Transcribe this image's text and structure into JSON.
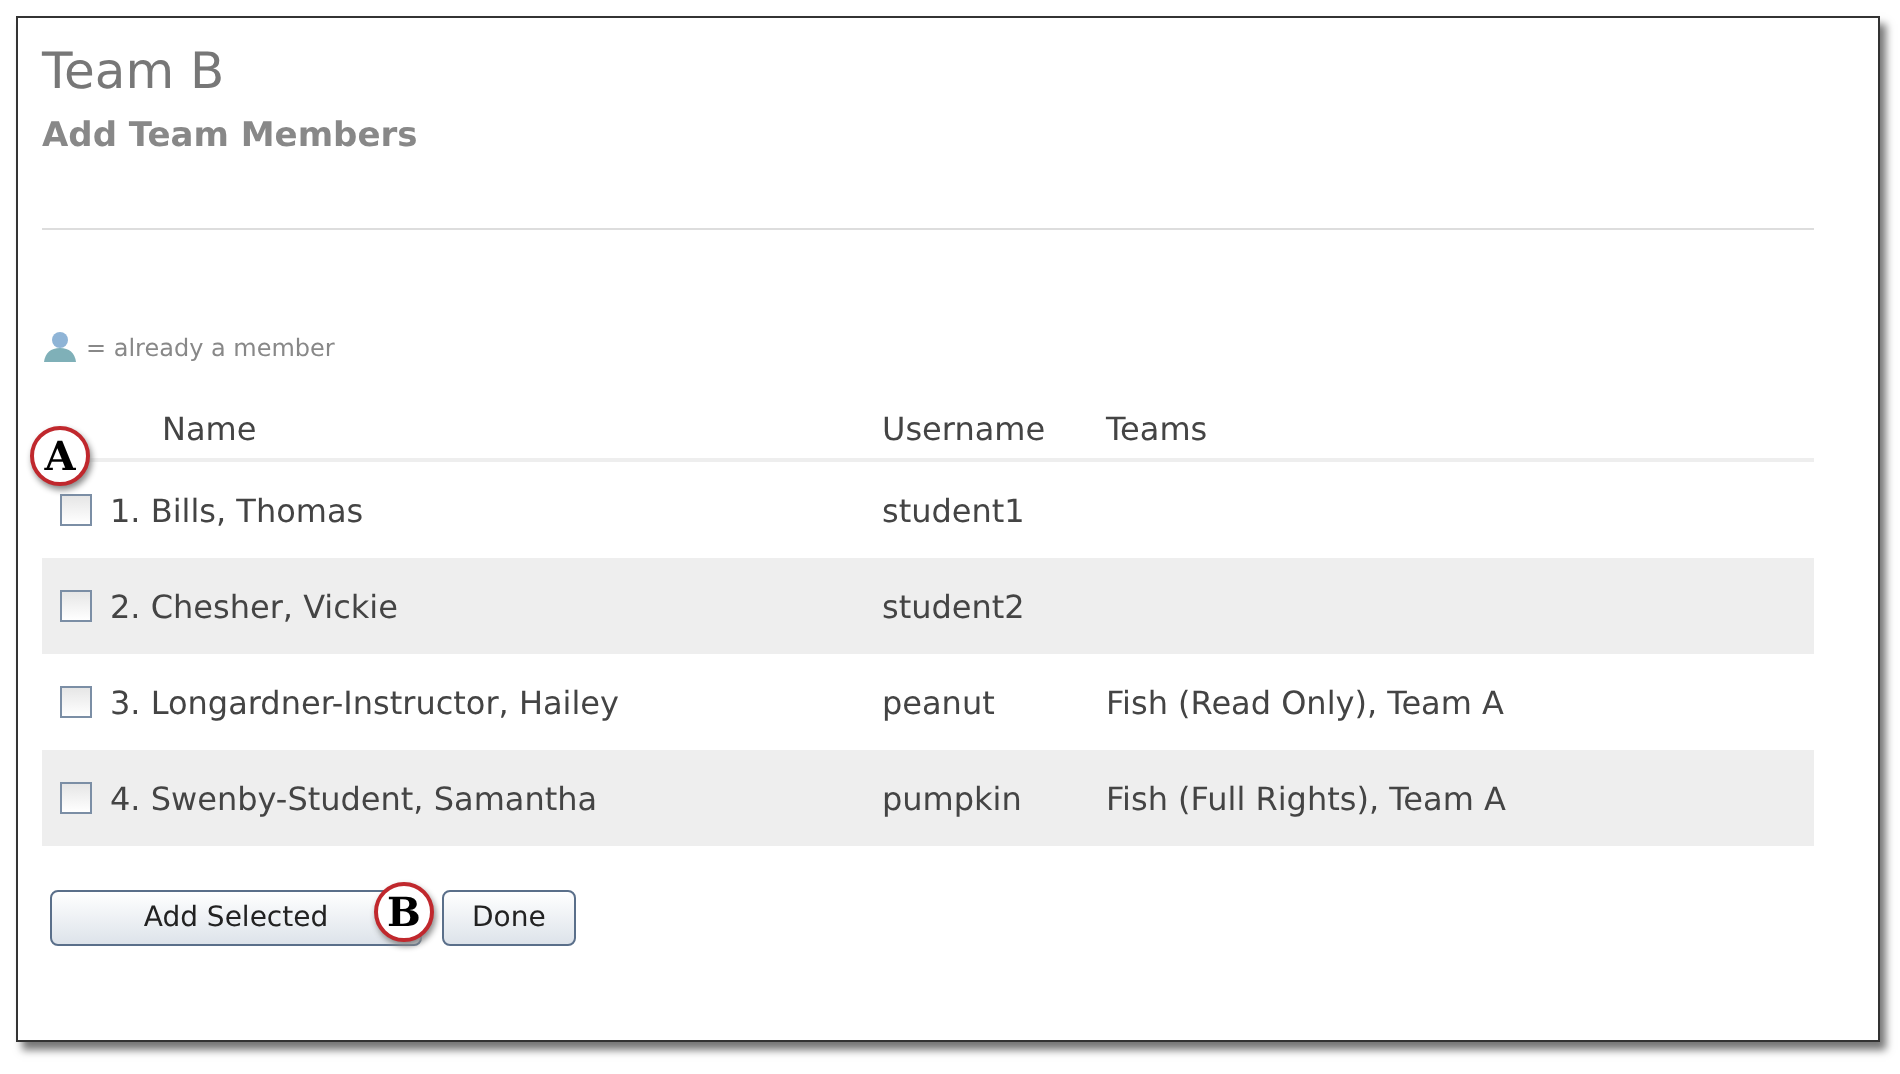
{
  "team_title": "Team B",
  "subtitle": "Add Team Members",
  "legend": {
    "text": "= already a member"
  },
  "table": {
    "columns": [
      "Name",
      "Username",
      "Teams"
    ],
    "rows": [
      {
        "name": "1. Bills, Thomas",
        "username": "student1",
        "teams": "",
        "checked": false
      },
      {
        "name": "2. Chesher, Vickie",
        "username": "student2",
        "teams": "",
        "checked": false
      },
      {
        "name": "3. Longardner-Instructor, Hailey",
        "username": "peanut",
        "teams": "Fish (Read Only), Team A",
        "checked": false
      },
      {
        "name": "4. Swenby-Student, Samantha",
        "username": "pumpkin",
        "teams": "Fish (Full Rights), Team A",
        "checked": false
      }
    ]
  },
  "buttons": [
    "Add Selected",
    "Done"
  ],
  "callouts": [
    {
      "label": "A"
    },
    {
      "label": "B"
    }
  ]
}
